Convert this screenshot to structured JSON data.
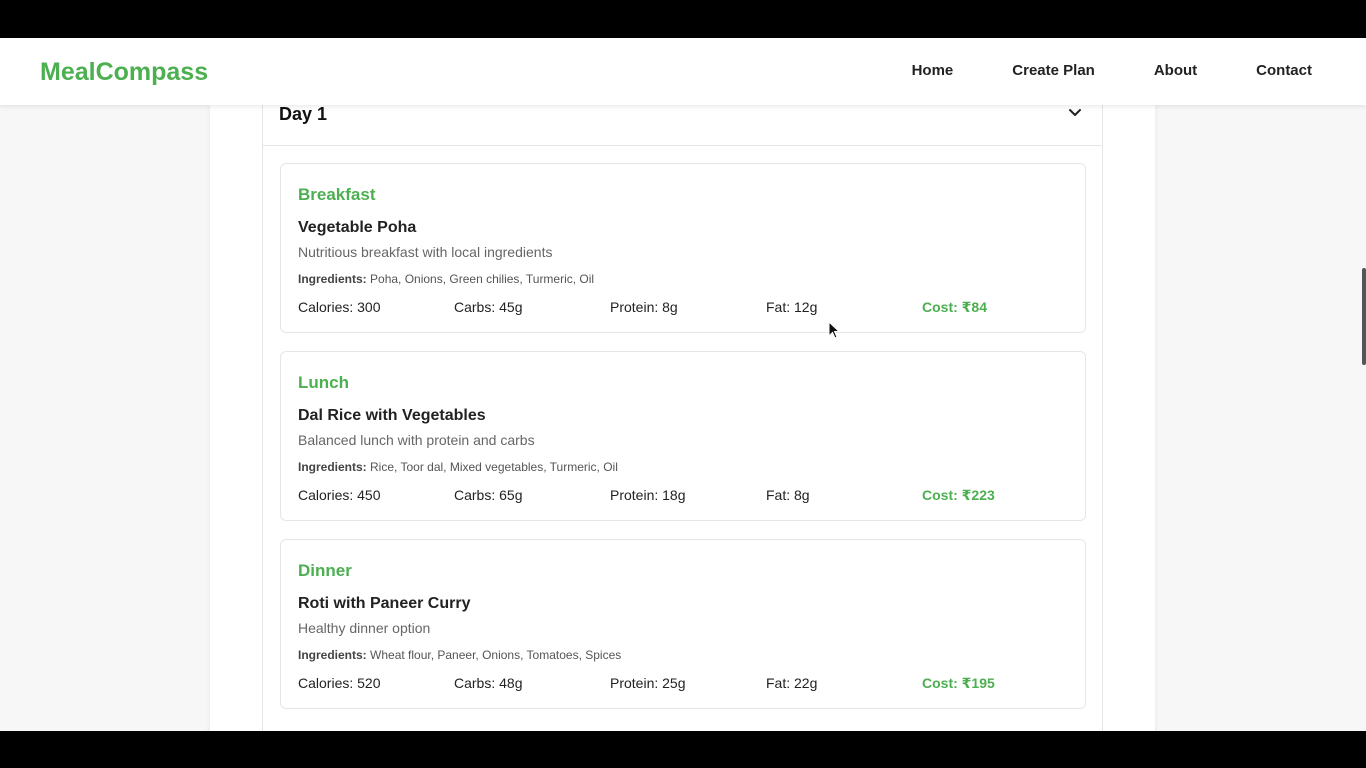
{
  "nav": {
    "brand": "MealCompass",
    "links": [
      "Home",
      "Create Plan",
      "About",
      "Contact"
    ]
  },
  "day": {
    "title": "Day 1"
  },
  "meals": [
    {
      "type": "Breakfast",
      "name": "Vegetable Poha",
      "description": "Nutritious breakfast with local ingredients",
      "ingredients_label": "Ingredients:",
      "ingredients": "Poha, Onions, Green chilies, Turmeric, Oil",
      "calories": "Calories: 300",
      "carbs": "Carbs: 45g",
      "protein": "Protein: 8g",
      "fat": "Fat: 12g",
      "cost": "Cost: ₹84"
    },
    {
      "type": "Lunch",
      "name": "Dal Rice with Vegetables",
      "description": "Balanced lunch with protein and carbs",
      "ingredients_label": "Ingredients:",
      "ingredients": "Rice, Toor dal, Mixed vegetables, Turmeric, Oil",
      "calories": "Calories: 450",
      "carbs": "Carbs: 65g",
      "protein": "Protein: 18g",
      "fat": "Fat: 8g",
      "cost": "Cost: ₹223"
    },
    {
      "type": "Dinner",
      "name": "Roti with Paneer Curry",
      "description": "Healthy dinner option",
      "ingredients_label": "Ingredients:",
      "ingredients": "Wheat flour, Paneer, Onions, Tomatoes, Spices",
      "calories": "Calories: 520",
      "carbs": "Carbs: 48g",
      "protein": "Protein: 25g",
      "fat": "Fat: 22g",
      "cost": "Cost: ₹195"
    }
  ],
  "colors": {
    "accent": "#4caf50",
    "text": "#222222",
    "muted": "#666666"
  },
  "icons": {
    "day_toggle": "chevron-down-icon",
    "pointer": "mouse-cursor-icon"
  }
}
